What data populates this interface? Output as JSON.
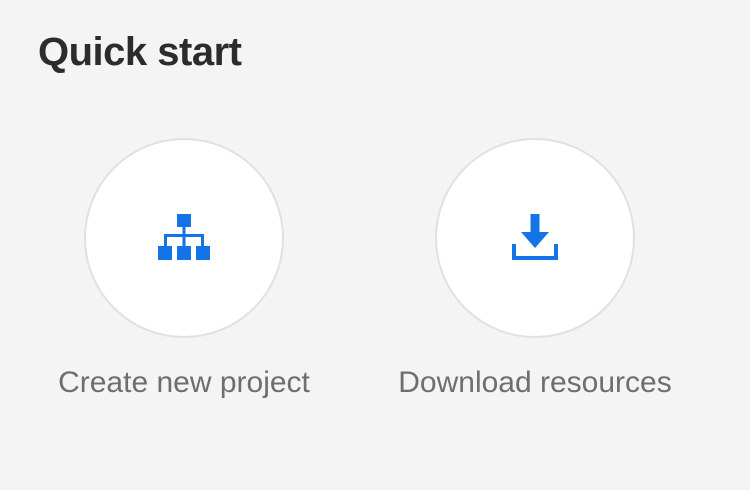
{
  "quick_start": {
    "title": "Quick start",
    "actions": [
      {
        "label": "Create new project",
        "icon": "hierarchy-icon",
        "icon_color": "#1473e6"
      },
      {
        "label": "Download resources",
        "icon": "download-icon",
        "icon_color": "#1473e6"
      }
    ]
  },
  "colors": {
    "background": "#f4f4f4",
    "circle_fill": "#ffffff",
    "circle_border": "#e1e1e1",
    "title_text": "#2c2c2c",
    "label_text": "#6e6e6e",
    "accent": "#1473e6"
  }
}
